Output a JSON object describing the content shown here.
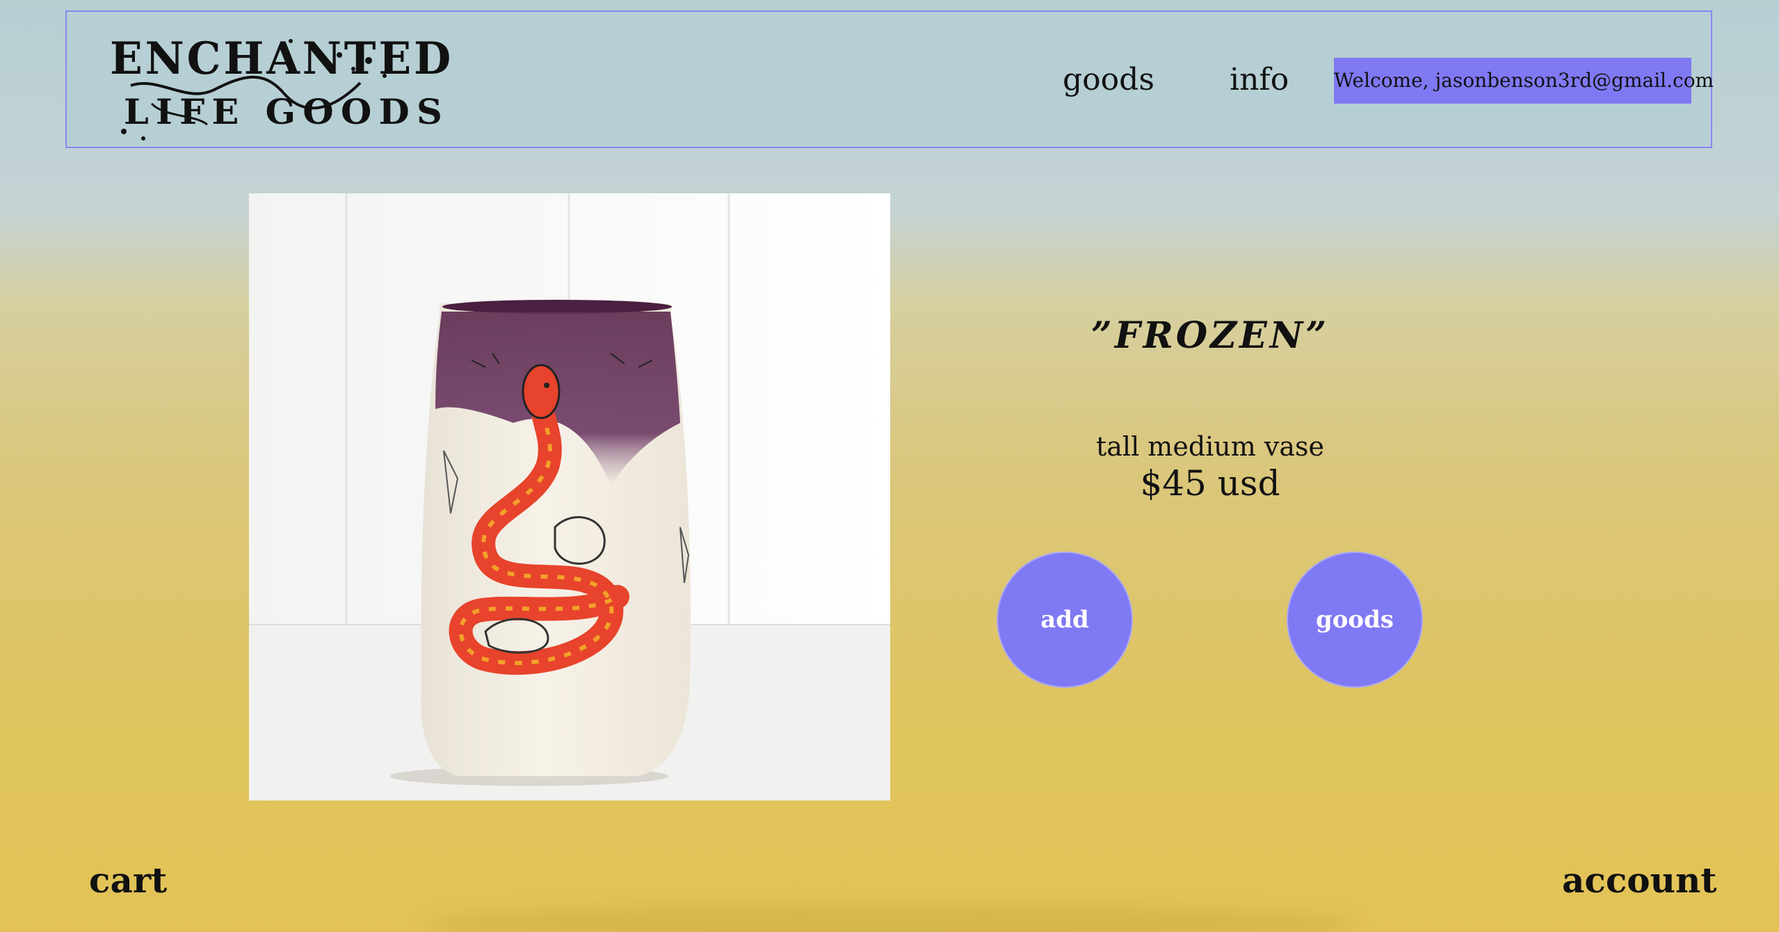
{
  "colors": {
    "accent": "#8079f4",
    "header_bg": "#b6cfd4",
    "header_border": "#8a86f0",
    "bg_top": "#b6cfd3",
    "bg_bottom": "#e3c356",
    "text": "#111111"
  },
  "header": {
    "logo_line1": "ENCHANTED",
    "logo_line2": "LIFE GOODS",
    "nav": [
      {
        "label": "goods"
      },
      {
        "label": "info"
      }
    ],
    "welcome": "Welcome, jasonbenson3rd@gmail.com"
  },
  "product": {
    "image_icon": "snake-vase-photo",
    "title": "”FROZEN”",
    "description": "tall medium vase",
    "price": "$45 usd",
    "add_label": "add",
    "goods_label": "goods"
  },
  "footer": {
    "cart_label": "cart",
    "account_label": "account"
  }
}
